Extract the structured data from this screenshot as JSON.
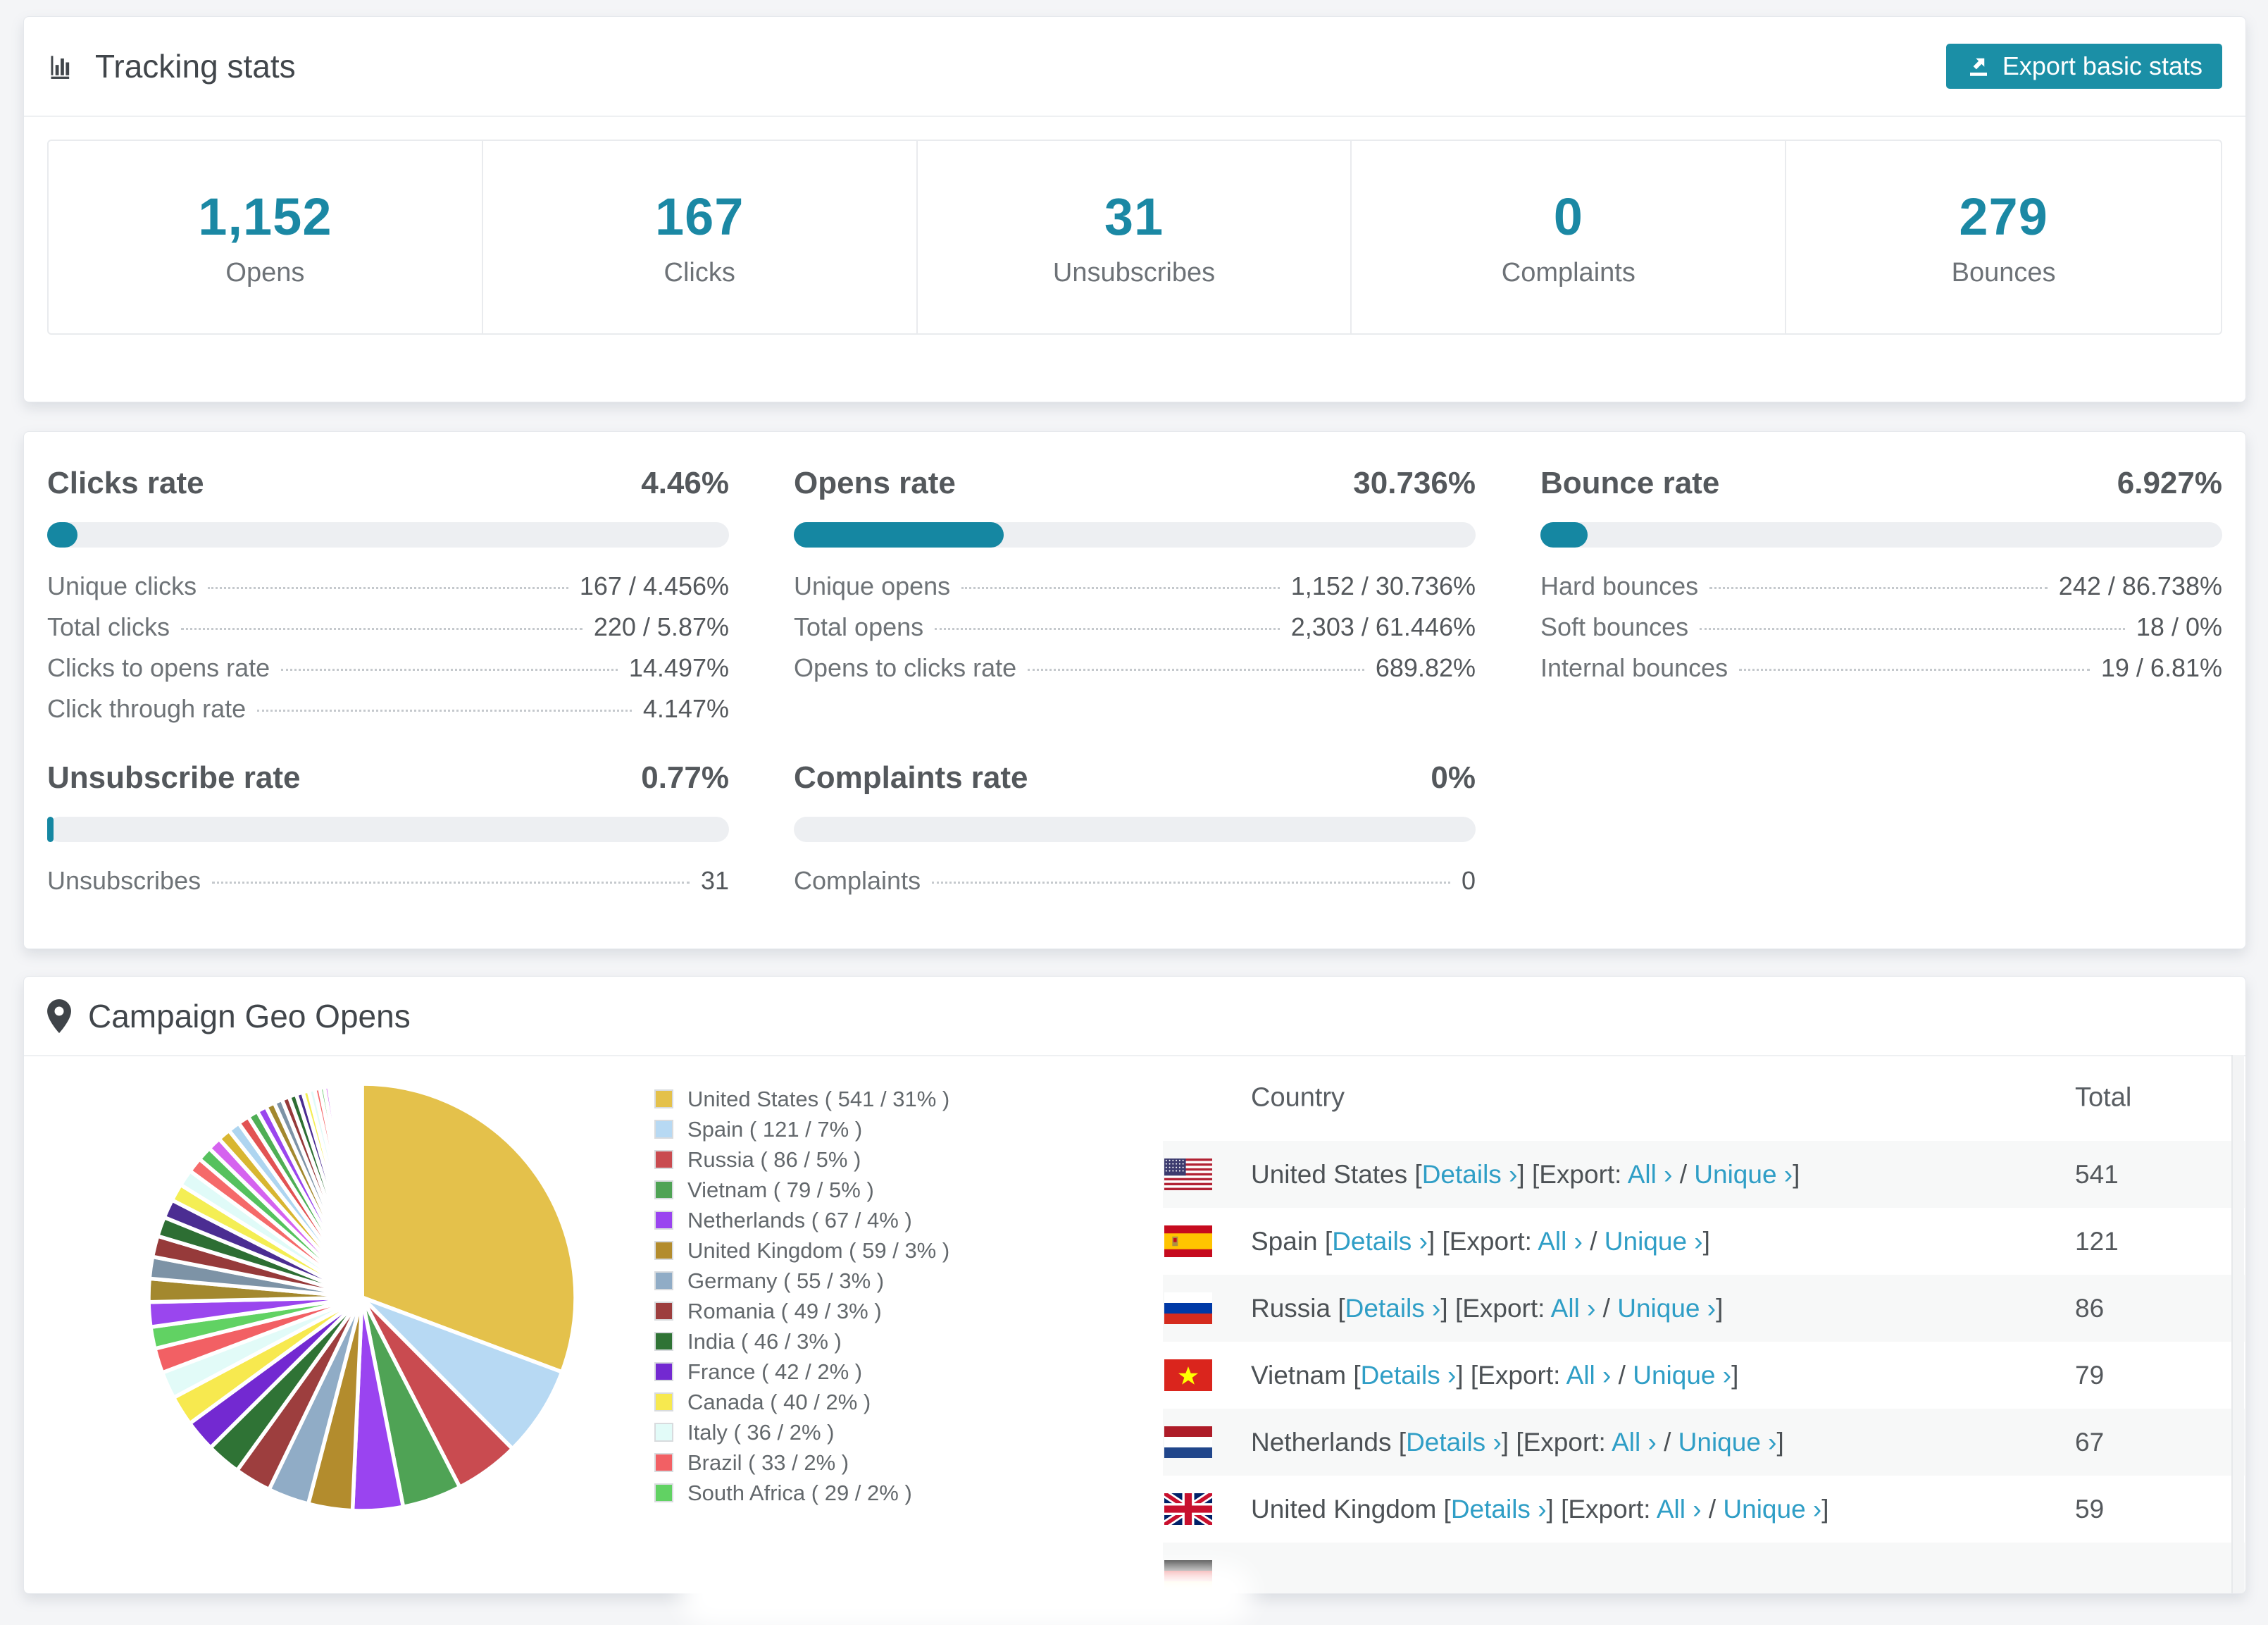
{
  "accent": "#1587a2",
  "button_color": "#1b8fa6",
  "link_color": "#2f9ec6",
  "tracking": {
    "title": "Tracking stats",
    "export_label": "Export basic stats",
    "stats": [
      {
        "value": "1,152",
        "label": "Opens"
      },
      {
        "value": "167",
        "label": "Clicks"
      },
      {
        "value": "31",
        "label": "Unsubscribes"
      },
      {
        "value": "0",
        "label": "Complaints"
      },
      {
        "value": "279",
        "label": "Bounces"
      }
    ]
  },
  "rates": {
    "blocks": [
      {
        "title": "Clicks rate",
        "value": "4.46%",
        "percent": 4.46,
        "rows": [
          {
            "label": "Unique clicks",
            "value": "167 / 4.456%"
          },
          {
            "label": "Total clicks",
            "value": "220 / 5.87%"
          },
          {
            "label": "Clicks to opens rate",
            "value": "14.497%"
          },
          {
            "label": "Click through rate",
            "value": "4.147%"
          }
        ]
      },
      {
        "title": "Opens rate",
        "value": "30.736%",
        "percent": 30.736,
        "rows": [
          {
            "label": "Unique opens",
            "value": "1,152 / 30.736%"
          },
          {
            "label": "Total opens",
            "value": "2,303 / 61.446%"
          },
          {
            "label": "Opens to clicks rate",
            "value": "689.82%"
          }
        ]
      },
      {
        "title": "Bounce rate",
        "value": "6.927%",
        "percent": 6.927,
        "rows": [
          {
            "label": "Hard bounces",
            "value": "242 / 86.738%"
          },
          {
            "label": "Soft bounces",
            "value": "18 / 0%"
          },
          {
            "label": "Internal bounces",
            "value": "19 / 6.81%"
          }
        ]
      },
      {
        "title": "Unsubscribe rate",
        "value": "0.77%",
        "percent": 0.77,
        "rows": [
          {
            "label": "Unsubscribes",
            "value": "31"
          }
        ]
      },
      {
        "title": "Complaints rate",
        "value": "0%",
        "percent": 0,
        "rows": [
          {
            "label": "Complaints",
            "value": "0"
          }
        ]
      }
    ]
  },
  "geo": {
    "title": "Campaign Geo Opens",
    "legend": [
      {
        "label": "United States ( 541 / 31% )",
        "color": "#e4c14b"
      },
      {
        "label": "Spain ( 121 / 7% )",
        "color": "#b7d9f3"
      },
      {
        "label": "Russia ( 86 / 5% )",
        "color": "#c94b50"
      },
      {
        "label": "Vietnam ( 79 / 5% )",
        "color": "#4fa355"
      },
      {
        "label": "Netherlands ( 67 / 4% )",
        "color": "#9a44f0"
      },
      {
        "label": "United Kingdom ( 59 / 3% )",
        "color": "#b38c2d"
      },
      {
        "label": "Germany ( 55 / 3% )",
        "color": "#90acc6"
      },
      {
        "label": "Romania ( 49 / 3% )",
        "color": "#9d3e3e"
      },
      {
        "label": "India ( 46 / 3% )",
        "color": "#2f7335"
      },
      {
        "label": "France ( 42 / 2% )",
        "color": "#7329d1"
      },
      {
        "label": "Canada ( 40 / 2% )",
        "color": "#f7e94f"
      },
      {
        "label": "Italy ( 36 / 2% )",
        "color": "#e2fbf8"
      },
      {
        "label": "Brazil ( 33 / 2% )",
        "color": "#f26064"
      },
      {
        "label": "South Africa ( 29 / 2% )",
        "color": "#61d263"
      }
    ],
    "table": {
      "headers": [
        "Country",
        "Total"
      ],
      "link_labels": {
        "details": "Details ›",
        "export_prefix": "[Export:",
        "all": "All ›",
        "slash": "/",
        "unique": "Unique ›",
        "open_bracket": "[",
        "close_bracket": "]"
      },
      "rows": [
        {
          "country": "United States",
          "flag": "us",
          "total": "541",
          "partial": false
        },
        {
          "country": "Spain",
          "flag": "es",
          "total": "121",
          "partial": false
        },
        {
          "country": "Russia",
          "flag": "ru",
          "total": "86",
          "partial": false
        },
        {
          "country": "Vietnam",
          "flag": "vn",
          "total": "79",
          "partial": false
        },
        {
          "country": "Netherlands",
          "flag": "nl",
          "total": "67",
          "partial": false
        },
        {
          "country": "United Kingdom",
          "flag": "gb",
          "total": "59",
          "partial": false
        },
        {
          "country": "",
          "flag": "de",
          "total": "",
          "partial": true
        }
      ]
    }
  },
  "chart_data": {
    "type": "pie",
    "title": "Campaign Geo Opens",
    "legend_position": "right",
    "start_angle_deg": 0,
    "direction": "clockwise",
    "series": [
      {
        "name": "United States",
        "value": 541,
        "pct": "31%",
        "color": "#e4c14b"
      },
      {
        "name": "Spain",
        "value": 121,
        "pct": "7%",
        "color": "#b7d9f3"
      },
      {
        "name": "Russia",
        "value": 86,
        "pct": "5%",
        "color": "#c94b50"
      },
      {
        "name": "Vietnam",
        "value": 79,
        "pct": "5%",
        "color": "#4fa355"
      },
      {
        "name": "Netherlands",
        "value": 67,
        "pct": "4%",
        "color": "#9a44f0"
      },
      {
        "name": "United Kingdom",
        "value": 59,
        "pct": "3%",
        "color": "#b38c2d"
      },
      {
        "name": "Germany",
        "value": 55,
        "pct": "3%",
        "color": "#90acc6"
      },
      {
        "name": "Romania",
        "value": 49,
        "pct": "3%",
        "color": "#9d3e3e"
      },
      {
        "name": "India",
        "value": 46,
        "pct": "3%",
        "color": "#2f7335"
      },
      {
        "name": "France",
        "value": 42,
        "pct": "2%",
        "color": "#7329d1"
      },
      {
        "name": "Canada",
        "value": 40,
        "pct": "2%",
        "color": "#f7e94f"
      },
      {
        "name": "Italy",
        "value": 36,
        "pct": "2%",
        "color": "#e2fbf8"
      },
      {
        "name": "Brazil",
        "value": 33,
        "pct": "2%",
        "color": "#f26064"
      },
      {
        "name": "South Africa",
        "value": 29,
        "pct": "2%",
        "color": "#61d263"
      }
    ],
    "others_estimated_values": [
      33,
      31,
      29,
      28,
      26,
      25,
      23,
      22,
      20,
      19,
      18,
      17,
      16,
      15,
      14,
      13,
      12,
      11,
      10,
      10,
      9,
      8,
      8,
      7,
      6,
      6,
      5,
      5,
      4,
      4,
      3,
      3,
      3,
      2,
      2,
      2,
      2,
      1,
      1,
      1,
      1,
      1,
      1,
      1,
      1,
      1
    ],
    "others_palette": [
      "#9a46ee",
      "#a3882e",
      "#7d93a6",
      "#963a3a",
      "#2d6e33",
      "#4b2d92",
      "#f4ee54",
      "#e0fbf8",
      "#f56a6a",
      "#56c15e",
      "#d563ef",
      "#d8b631",
      "#aed5f0",
      "#e25353",
      "#4fae55"
    ]
  }
}
